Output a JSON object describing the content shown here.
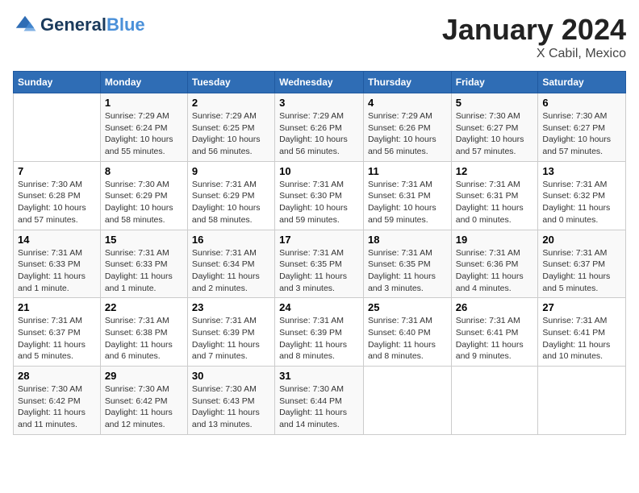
{
  "header": {
    "logo_line1": "General",
    "logo_line2": "Blue",
    "month": "January 2024",
    "location": "X Cabil, Mexico"
  },
  "weekdays": [
    "Sunday",
    "Monday",
    "Tuesday",
    "Wednesday",
    "Thursday",
    "Friday",
    "Saturday"
  ],
  "weeks": [
    [
      {
        "day": "",
        "info": ""
      },
      {
        "day": "1",
        "info": "Sunrise: 7:29 AM\nSunset: 6:24 PM\nDaylight: 10 hours\nand 55 minutes."
      },
      {
        "day": "2",
        "info": "Sunrise: 7:29 AM\nSunset: 6:25 PM\nDaylight: 10 hours\nand 56 minutes."
      },
      {
        "day": "3",
        "info": "Sunrise: 7:29 AM\nSunset: 6:26 PM\nDaylight: 10 hours\nand 56 minutes."
      },
      {
        "day": "4",
        "info": "Sunrise: 7:29 AM\nSunset: 6:26 PM\nDaylight: 10 hours\nand 56 minutes."
      },
      {
        "day": "5",
        "info": "Sunrise: 7:30 AM\nSunset: 6:27 PM\nDaylight: 10 hours\nand 57 minutes."
      },
      {
        "day": "6",
        "info": "Sunrise: 7:30 AM\nSunset: 6:27 PM\nDaylight: 10 hours\nand 57 minutes."
      }
    ],
    [
      {
        "day": "7",
        "info": "Sunrise: 7:30 AM\nSunset: 6:28 PM\nDaylight: 10 hours\nand 57 minutes."
      },
      {
        "day": "8",
        "info": "Sunrise: 7:30 AM\nSunset: 6:29 PM\nDaylight: 10 hours\nand 58 minutes."
      },
      {
        "day": "9",
        "info": "Sunrise: 7:31 AM\nSunset: 6:29 PM\nDaylight: 10 hours\nand 58 minutes."
      },
      {
        "day": "10",
        "info": "Sunrise: 7:31 AM\nSunset: 6:30 PM\nDaylight: 10 hours\nand 59 minutes."
      },
      {
        "day": "11",
        "info": "Sunrise: 7:31 AM\nSunset: 6:31 PM\nDaylight: 10 hours\nand 59 minutes."
      },
      {
        "day": "12",
        "info": "Sunrise: 7:31 AM\nSunset: 6:31 PM\nDaylight: 11 hours\nand 0 minutes."
      },
      {
        "day": "13",
        "info": "Sunrise: 7:31 AM\nSunset: 6:32 PM\nDaylight: 11 hours\nand 0 minutes."
      }
    ],
    [
      {
        "day": "14",
        "info": "Sunrise: 7:31 AM\nSunset: 6:33 PM\nDaylight: 11 hours\nand 1 minute."
      },
      {
        "day": "15",
        "info": "Sunrise: 7:31 AM\nSunset: 6:33 PM\nDaylight: 11 hours\nand 1 minute."
      },
      {
        "day": "16",
        "info": "Sunrise: 7:31 AM\nSunset: 6:34 PM\nDaylight: 11 hours\nand 2 minutes."
      },
      {
        "day": "17",
        "info": "Sunrise: 7:31 AM\nSunset: 6:35 PM\nDaylight: 11 hours\nand 3 minutes."
      },
      {
        "day": "18",
        "info": "Sunrise: 7:31 AM\nSunset: 6:35 PM\nDaylight: 11 hours\nand 3 minutes."
      },
      {
        "day": "19",
        "info": "Sunrise: 7:31 AM\nSunset: 6:36 PM\nDaylight: 11 hours\nand 4 minutes."
      },
      {
        "day": "20",
        "info": "Sunrise: 7:31 AM\nSunset: 6:37 PM\nDaylight: 11 hours\nand 5 minutes."
      }
    ],
    [
      {
        "day": "21",
        "info": "Sunrise: 7:31 AM\nSunset: 6:37 PM\nDaylight: 11 hours\nand 5 minutes."
      },
      {
        "day": "22",
        "info": "Sunrise: 7:31 AM\nSunset: 6:38 PM\nDaylight: 11 hours\nand 6 minutes."
      },
      {
        "day": "23",
        "info": "Sunrise: 7:31 AM\nSunset: 6:39 PM\nDaylight: 11 hours\nand 7 minutes."
      },
      {
        "day": "24",
        "info": "Sunrise: 7:31 AM\nSunset: 6:39 PM\nDaylight: 11 hours\nand 8 minutes."
      },
      {
        "day": "25",
        "info": "Sunrise: 7:31 AM\nSunset: 6:40 PM\nDaylight: 11 hours\nand 8 minutes."
      },
      {
        "day": "26",
        "info": "Sunrise: 7:31 AM\nSunset: 6:41 PM\nDaylight: 11 hours\nand 9 minutes."
      },
      {
        "day": "27",
        "info": "Sunrise: 7:31 AM\nSunset: 6:41 PM\nDaylight: 11 hours\nand 10 minutes."
      }
    ],
    [
      {
        "day": "28",
        "info": "Sunrise: 7:30 AM\nSunset: 6:42 PM\nDaylight: 11 hours\nand 11 minutes."
      },
      {
        "day": "29",
        "info": "Sunrise: 7:30 AM\nSunset: 6:42 PM\nDaylight: 11 hours\nand 12 minutes."
      },
      {
        "day": "30",
        "info": "Sunrise: 7:30 AM\nSunset: 6:43 PM\nDaylight: 11 hours\nand 13 minutes."
      },
      {
        "day": "31",
        "info": "Sunrise: 7:30 AM\nSunset: 6:44 PM\nDaylight: 11 hours\nand 14 minutes."
      },
      {
        "day": "",
        "info": ""
      },
      {
        "day": "",
        "info": ""
      },
      {
        "day": "",
        "info": ""
      }
    ]
  ]
}
